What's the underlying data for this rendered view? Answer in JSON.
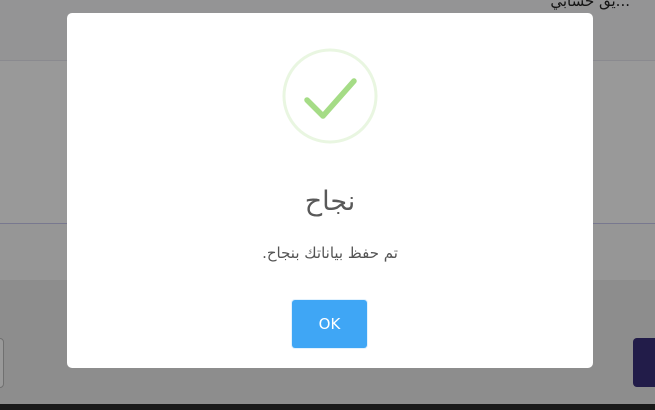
{
  "background": {
    "partial_text": "...يق حسابي"
  },
  "dialog": {
    "icon": "success-check-icon",
    "title": "نجاح",
    "message": "تم حفظ بياناتك بنجاح.",
    "ok_label": "OK"
  },
  "colors": {
    "ok_button": "#3fa6f5",
    "success_check": "#a5dc86",
    "success_ring": "#e9f6e1",
    "accent_button": "#3a2f7a"
  }
}
